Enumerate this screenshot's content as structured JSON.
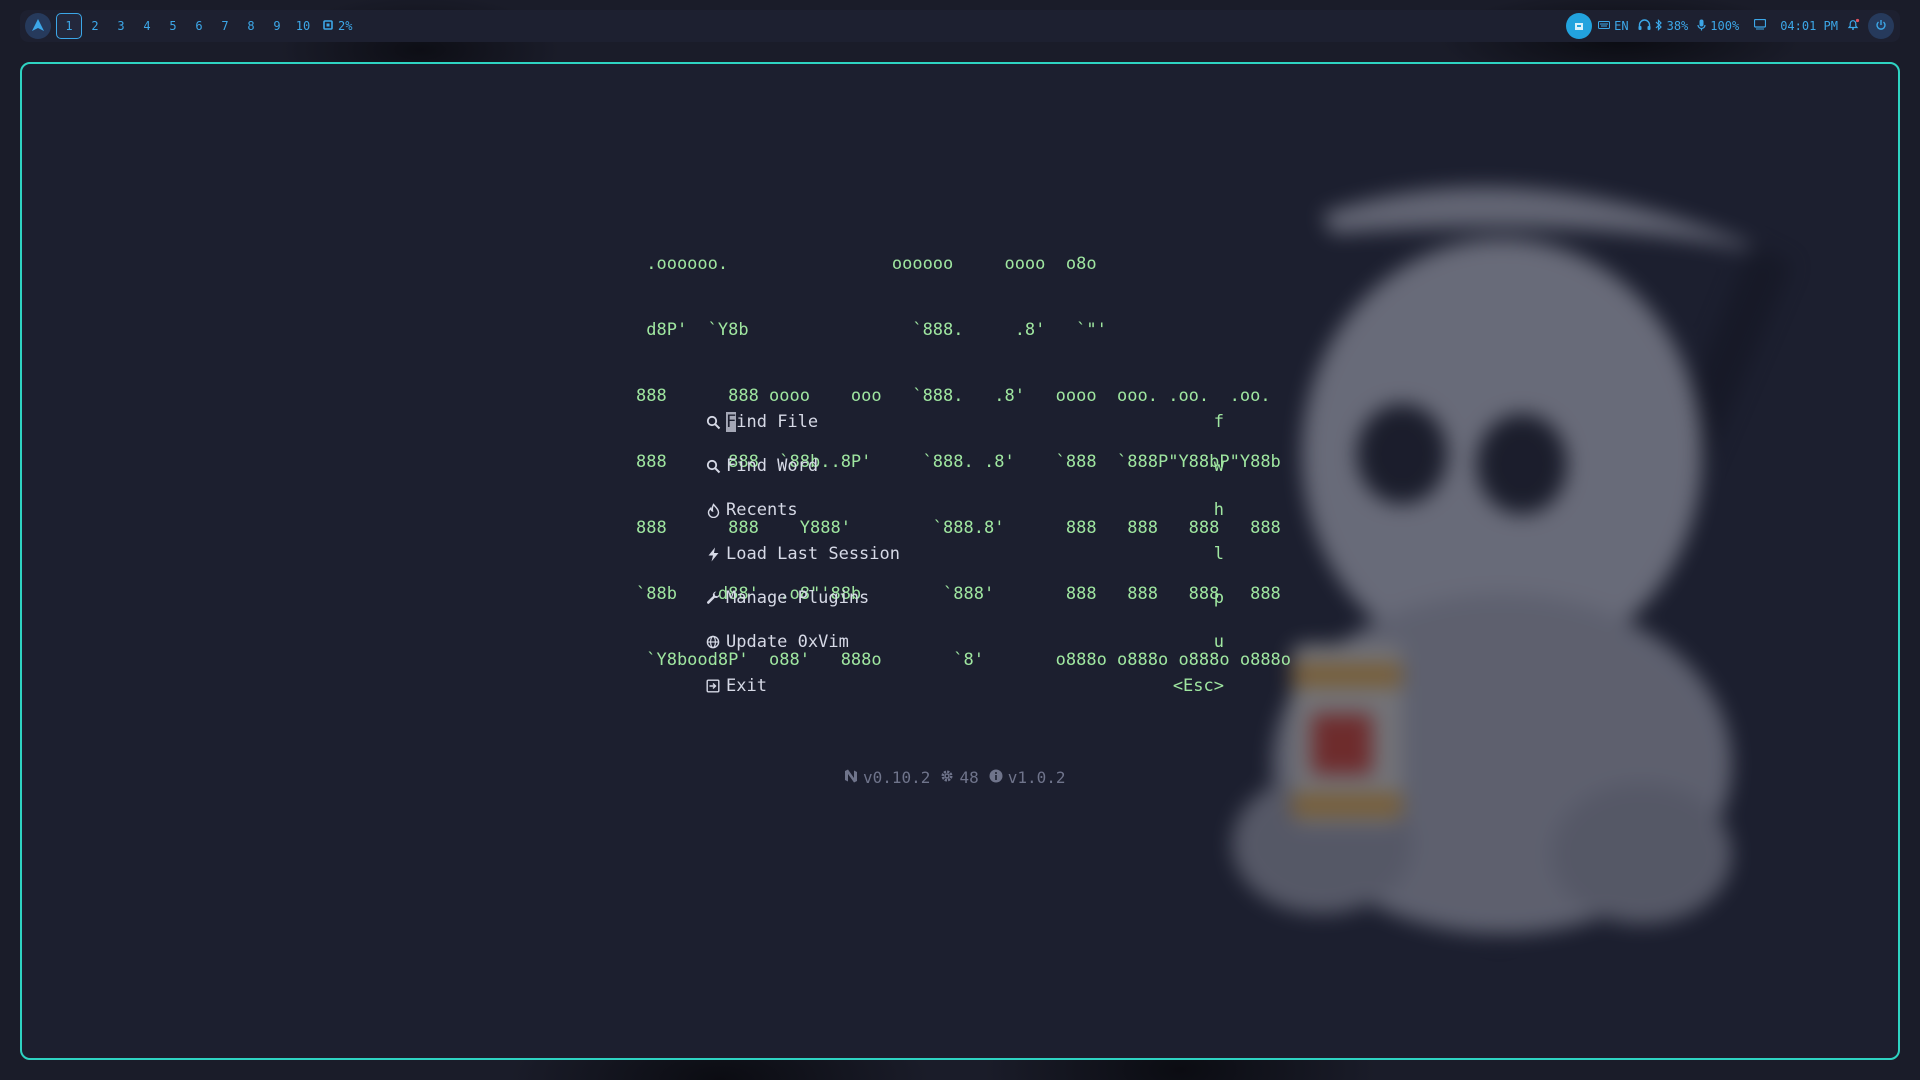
{
  "topbar": {
    "workspaces": [
      "1",
      "2",
      "3",
      "4",
      "5",
      "6",
      "7",
      "8",
      "9",
      "10"
    ],
    "active_workspace": "1",
    "cpu": "2%",
    "language": "EN",
    "volume": "38%",
    "mic": "100%",
    "clock": "04:01 PM"
  },
  "dashboard": {
    "ascii_art": [
      " .oooooo.                oooooo     oooo  o8o",
      " d8P'  `Y8b                `888.     .8'   `\"'",
      "888      888 oooo    ooo   `888.   .8'   oooo  ooo. .oo.  .oo.",
      "888      888  `88b..8P'     `888. .8'    `888  `888P\"Y88bP\"Y88b",
      "888      888    Y888'        `888.8'      888   888   888   888",
      "`88b    d88'  .o8\"'88b        `888'       888   888   888   888",
      " `Y8bood8P'  o88'   888o       `8'       o888o o888o o888o o888o"
    ],
    "menu": [
      {
        "cursor_char": "F",
        "label_rest": "ind File",
        "key": "f",
        "icon": "search-icon"
      },
      {
        "label": "Find Word",
        "key": "w",
        "icon": "search-icon"
      },
      {
        "label": "Recents",
        "key": "h",
        "icon": "history-icon"
      },
      {
        "label": "Load Last Session",
        "key": "l",
        "icon": "lightning-icon"
      },
      {
        "label": "Manage Plugins",
        "key": "p",
        "icon": "wrench-icon"
      },
      {
        "label": "Update 0xVim",
        "key": "u",
        "icon": "globe-icon"
      },
      {
        "label": "Exit",
        "key": "<Esc>",
        "icon": "exit-icon"
      }
    ],
    "footer": {
      "nvim_version": "v0.10.2",
      "plugin_count": "48",
      "config_version": "v1.0.2"
    }
  },
  "colors": {
    "accent": "#2ed3c2",
    "bar_text": "#3ca7e8",
    "ascii": "#9fe6a0",
    "menu_text": "#d6d9e6",
    "footer": "#6f748b"
  }
}
